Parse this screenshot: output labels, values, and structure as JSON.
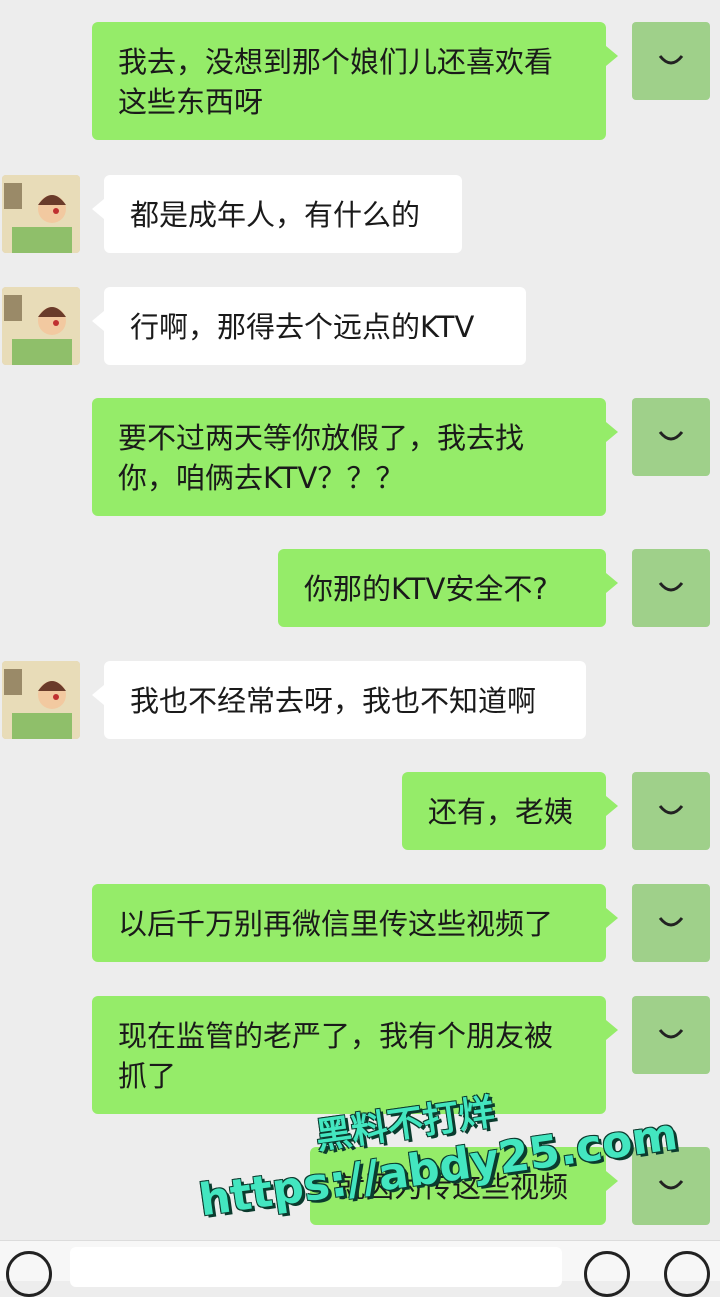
{
  "messages": [
    {
      "side": "me",
      "text": "我去，没想到那个娘们儿还喜欢看这些东西呀"
    },
    {
      "side": "them",
      "text": "都是成年人，有什么的"
    },
    {
      "side": "them",
      "text": "行啊，那得去个远点的KTV"
    },
    {
      "side": "me",
      "text": "要不过两天等你放假了，我去找你，咱俩去KTV？？？"
    },
    {
      "side": "me",
      "text": "你那的KTV安全不?"
    },
    {
      "side": "them",
      "text": "我也不经常去呀，我也不知道啊"
    },
    {
      "side": "me",
      "text": "还有，老姨"
    },
    {
      "side": "me",
      "text": "以后千万别再微信里传这些视频了"
    },
    {
      "side": "me",
      "text": "现在监管的老严了，我有个朋友被抓了"
    },
    {
      "side": "me",
      "text": "就因为传这些视频"
    }
  ],
  "watermark": {
    "line1": "黑料不打烊",
    "line2": "https://abdy25.com",
    "color": "#43e6c0"
  },
  "colors": {
    "my_bubble": "#95ec69",
    "their_bubble": "#ffffff",
    "background": "#ededed"
  },
  "icons": [
    "smiley-avatar-icon",
    "voice-icon",
    "emoji-icon",
    "plus-icon"
  ]
}
